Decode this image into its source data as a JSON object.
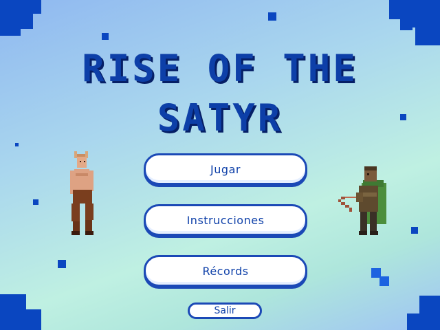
{
  "game": {
    "title_line1": "RISE OF THE",
    "title_line2": "SATYR"
  },
  "menu": {
    "play_label": "Jugar",
    "instructions_label": "Instrucciones",
    "records_label": "Récords",
    "exit_label": "Salir"
  },
  "colors": {
    "accent": "#0d3fa8",
    "button_bg": "#ffffff",
    "decor": "#0a46c0"
  },
  "characters": {
    "left": "satyr-sprite",
    "right": "archer-sprite"
  }
}
